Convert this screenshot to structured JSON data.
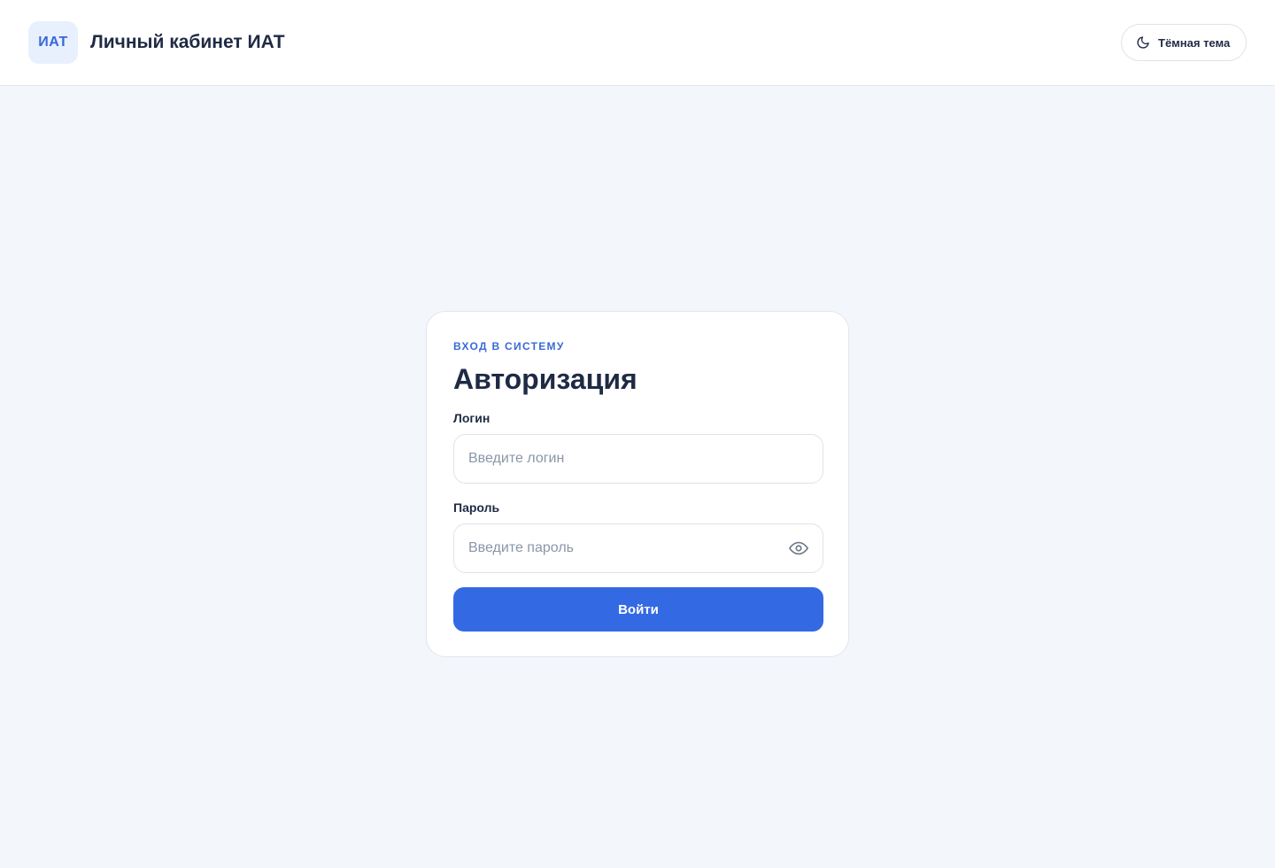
{
  "header": {
    "logo_text": "ИАТ",
    "title": "Личный кабинет ИАТ",
    "theme_toggle": {
      "label": "Тёмная тема",
      "icon": "moon-icon"
    }
  },
  "login_card": {
    "kicker": "ВХОД В СИСТЕМУ",
    "title": "Авторизация",
    "login": {
      "label": "Логин",
      "placeholder": "Введите логин",
      "value": ""
    },
    "password": {
      "label": "Пароль",
      "placeholder": "Введите пароль",
      "value": "",
      "toggle_icon": "eye-icon"
    },
    "submit_label": "Войти"
  },
  "colors": {
    "accent": "#3469e4",
    "page_background": "#f3f6fb",
    "text_primary": "#1f2a44"
  }
}
